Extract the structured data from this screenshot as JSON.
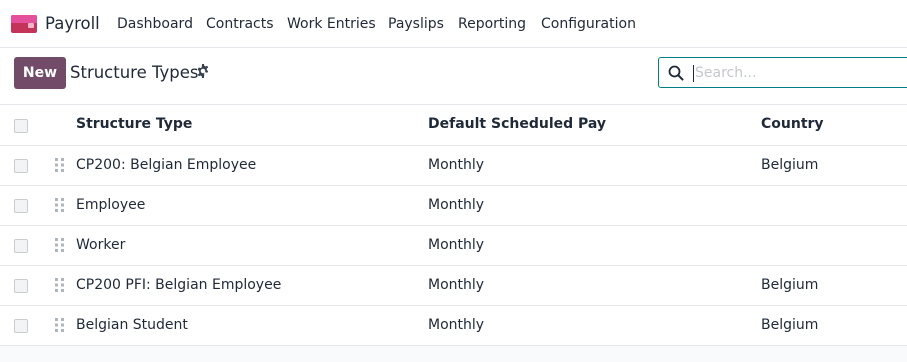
{
  "navbar": {
    "app_name": "Payroll",
    "menu": [
      "Dashboard",
      "Contracts",
      "Work Entries",
      "Payslips",
      "Reporting",
      "Configuration"
    ]
  },
  "control_panel": {
    "new_label": "New",
    "title": "Structure Types",
    "search_placeholder": "Search..."
  },
  "table": {
    "columns": [
      "Structure Type",
      "Default Scheduled Pay",
      "Country"
    ],
    "rows": [
      {
        "structure_type": "CP200: Belgian Employee",
        "pay": "Monthly",
        "country": "Belgium"
      },
      {
        "structure_type": "Employee",
        "pay": "Monthly",
        "country": ""
      },
      {
        "structure_type": "Worker",
        "pay": "Monthly",
        "country": ""
      },
      {
        "structure_type": "CP200 PFI: Belgian Employee",
        "pay": "Monthly",
        "country": "Belgium"
      },
      {
        "structure_type": "Belgian Student",
        "pay": "Monthly",
        "country": "Belgium"
      }
    ]
  },
  "colors": {
    "primary": "#714b67",
    "search_border": "#017e84",
    "brand_top": "#e4509b",
    "brand_bottom": "#c4335a"
  }
}
